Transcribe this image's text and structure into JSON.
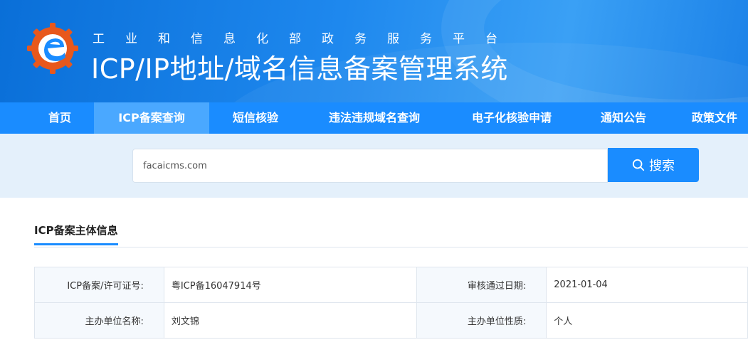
{
  "header": {
    "subtitle": "工业和信息化部政务服务平台",
    "title": "ICP/IP地址/域名信息备案管理系统",
    "logo_colors": {
      "ring": "#e8581c",
      "inner": "#1a8cff"
    }
  },
  "nav": {
    "items": [
      {
        "label": "首页",
        "active": false
      },
      {
        "label": "ICP备案查询",
        "active": true
      },
      {
        "label": "短信核验",
        "active": false
      },
      {
        "label": "违法违规域名查询",
        "active": false
      },
      {
        "label": "电子化核验申请",
        "active": false
      },
      {
        "label": "通知公告",
        "active": false
      },
      {
        "label": "政策文件",
        "active": false
      }
    ]
  },
  "search": {
    "value": "facaicms.com",
    "button_label": "搜索",
    "button_icon": "search-icon"
  },
  "section": {
    "title": "ICP备案主体信息"
  },
  "info": {
    "rows": [
      {
        "label1": "ICP备案/许可证号:",
        "value1": "粤ICP备16047914号",
        "label2": "审核通过日期:",
        "value2": "2021-01-04"
      },
      {
        "label1": "主办单位名称:",
        "value1": "刘文锦",
        "label2": "主办单位性质:",
        "value2": "个人"
      }
    ]
  },
  "colors": {
    "primary": "#1a8cff",
    "nav_active": "#4aa8ff",
    "search_bg": "#e4f0fb"
  }
}
